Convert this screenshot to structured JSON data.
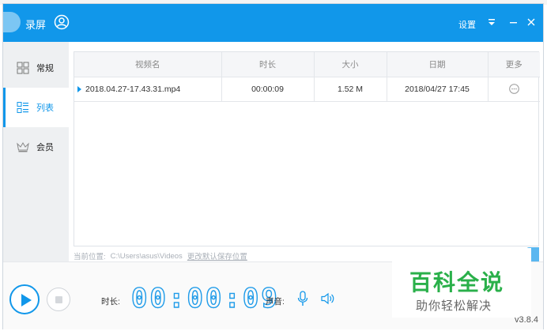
{
  "window": {
    "title": "录屏",
    "settings_label": "设置"
  },
  "sidebar": {
    "items": [
      {
        "label": "常规",
        "icon": "grid-icon",
        "active": false
      },
      {
        "label": "列表",
        "icon": "list-icon",
        "active": true
      },
      {
        "label": "会员",
        "icon": "crown-icon",
        "active": false
      }
    ]
  },
  "table": {
    "headers": [
      "视频名",
      "时长",
      "大小",
      "日期",
      "更多"
    ],
    "rows": [
      {
        "name": "2018.04.27-17.43.31.mp4",
        "duration": "00:00:09",
        "size": "1.52 M",
        "date": "2018/04/27 17:45"
      }
    ]
  },
  "path": {
    "label": "当前位置:",
    "value": "C:\\Users\\asus\\Videos",
    "change_link": "更改默认保存位置"
  },
  "recorder": {
    "duration_label": "时长:",
    "timer": {
      "h": "00",
      "m": "00",
      "s": "09"
    },
    "sound_label": "声音:"
  },
  "watermark": {
    "title": "百科全说",
    "subtitle": "助你轻松解决"
  },
  "version": "v3.8.4",
  "colors": {
    "accent": "#1197ea",
    "watermark_green": "#2ab04a"
  }
}
